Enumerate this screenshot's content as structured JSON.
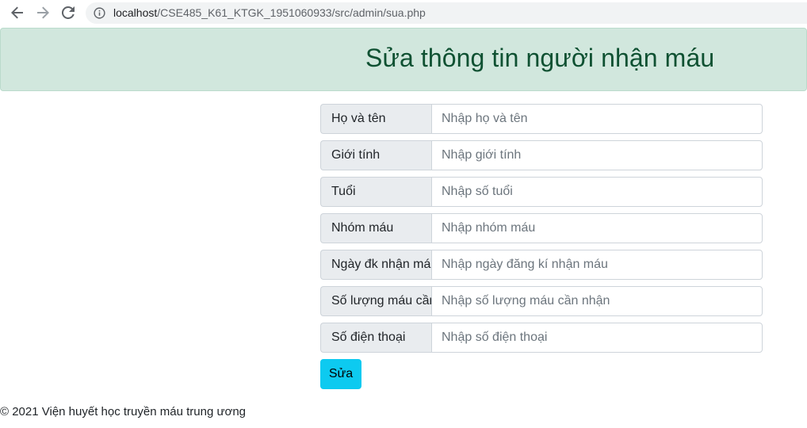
{
  "browser": {
    "url_host": "localhost",
    "url_path": "/CSE485_K61_KTGK_1951060933/src/admin/sua.php",
    "icons": [
      "back-arrow-icon",
      "forward-arrow-icon",
      "reload-icon",
      "info-icon"
    ]
  },
  "header": {
    "title": "Sửa thông tin người nhận máu",
    "background": "#d1e7dd",
    "text_color": "#0f5132"
  },
  "form": {
    "fields": [
      {
        "label": "Họ và tên",
        "placeholder": "Nhập họ và tên",
        "value": ""
      },
      {
        "label": "Giới tính",
        "placeholder": "Nhập giới tính",
        "value": ""
      },
      {
        "label": "Tuổi",
        "placeholder": "Nhập số tuổi",
        "value": ""
      },
      {
        "label": "Nhóm máu",
        "placeholder": "Nhập nhóm máu",
        "value": ""
      },
      {
        "label": "Ngày đk nhận má",
        "placeholder": "Nhập ngày đăng kí nhận máu",
        "value": ""
      },
      {
        "label": "Số lượng máu cần",
        "placeholder": "Nhập số lượng máu cần nhận",
        "value": ""
      },
      {
        "label": "Số điện thoại",
        "placeholder": "Nhập số điện thoại",
        "value": ""
      }
    ],
    "submit_label": "Sửa",
    "submit_color": "#0dcaf0"
  },
  "footer": {
    "text": "© 2021 Viện huyết học truyền máu trung ương"
  }
}
